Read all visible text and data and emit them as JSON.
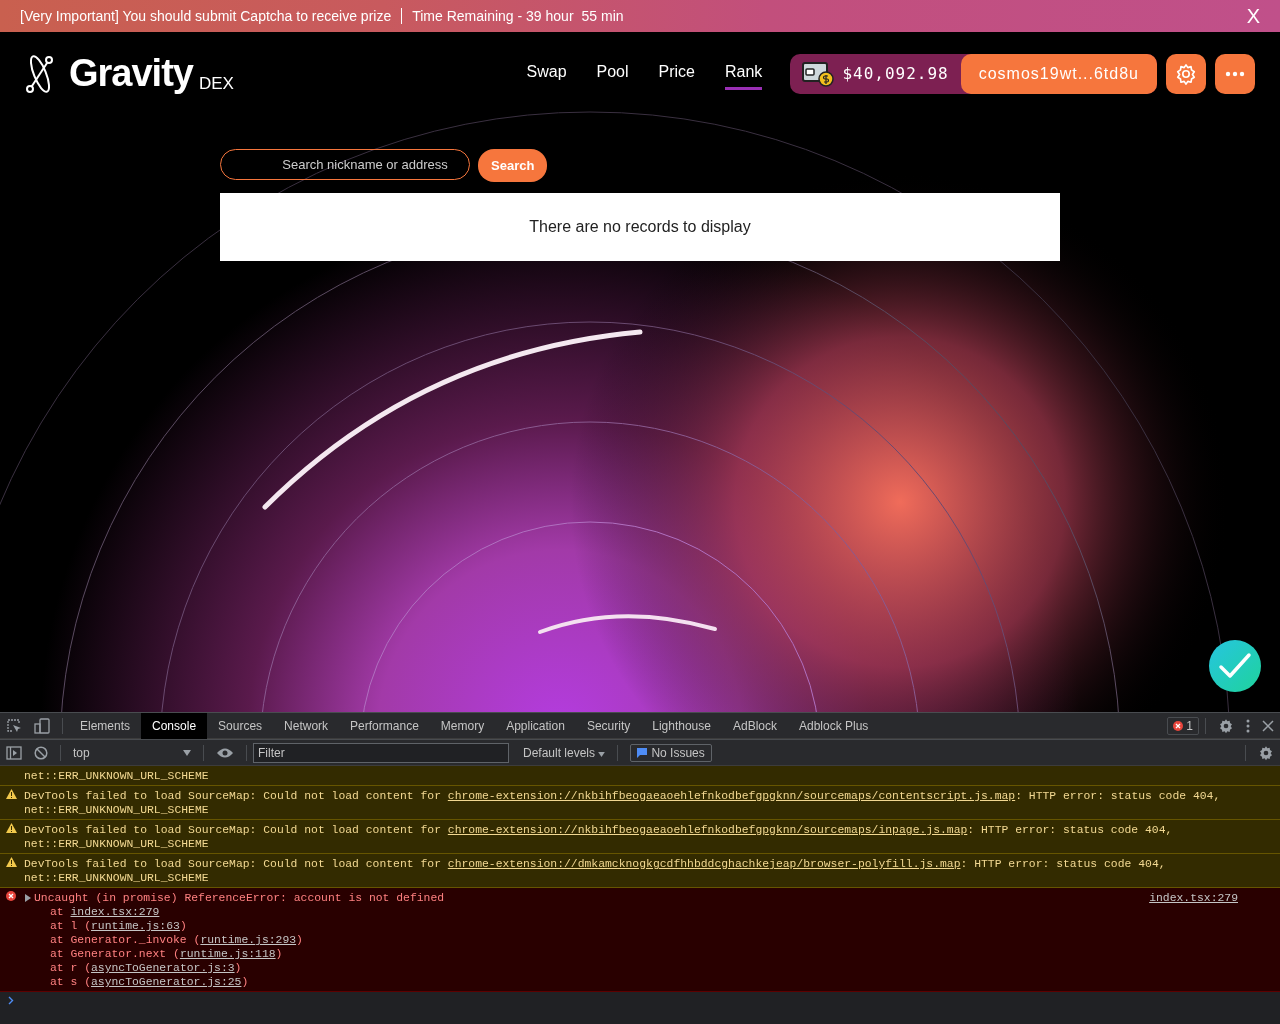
{
  "banner": {
    "message": "[Very Important] You should submit Captcha to receive prize",
    "time": "Time Remaining - 39 hour",
    "minutes": "55 min",
    "close": "X"
  },
  "header": {
    "logo": "Gravity",
    "logo_suffix": "DEX",
    "nav": [
      {
        "label": "Swap",
        "selected": false
      },
      {
        "label": "Pool",
        "selected": false
      },
      {
        "label": "Price",
        "selected": false
      },
      {
        "label": "Rank",
        "selected": true
      }
    ],
    "balance": "$40,092.98",
    "address": "cosmos19wt...6td8u"
  },
  "search": {
    "placeholder": "Search nickname or address",
    "button": "Search"
  },
  "table": {
    "empty_message": "There are no records to display"
  },
  "devtools": {
    "tabs": [
      {
        "label": "Elements",
        "selected": false
      },
      {
        "label": "Console",
        "selected": true
      },
      {
        "label": "Sources",
        "selected": false
      },
      {
        "label": "Network",
        "selected": false
      },
      {
        "label": "Performance",
        "selected": false
      },
      {
        "label": "Memory",
        "selected": false
      },
      {
        "label": "Application",
        "selected": false
      },
      {
        "label": "Security",
        "selected": false
      },
      {
        "label": "Lighthouse",
        "selected": false
      },
      {
        "label": "AdBlock",
        "selected": false
      },
      {
        "label": "Adblock Plus",
        "selected": false
      }
    ],
    "error_count": "1",
    "context": "top",
    "filter_placeholder": "Filter",
    "levels": "Default levels",
    "issues": "No Issues",
    "messages": [
      {
        "kind": "warning",
        "lines": [
          "net::ERR_UNKNOWN_URL_SCHEME"
        ]
      },
      {
        "kind": "warning",
        "prefix": "DevTools failed to load SourceMap: Could not load content for ",
        "link": "chrome-extension://nkbihfbeogaeaoehlefnkodbefgpgknn/sourcemaps/contentscript.js.map",
        "suffix": ": HTTP error: status code 404,",
        "lines": [
          "net::ERR_UNKNOWN_URL_SCHEME"
        ]
      },
      {
        "kind": "warning",
        "prefix": "DevTools failed to load SourceMap: Could not load content for ",
        "link": "chrome-extension://nkbihfbeogaeaoehlefnkodbefgpgknn/sourcemaps/inpage.js.map",
        "suffix": ": HTTP error: status code 404,",
        "lines": [
          "net::ERR_UNKNOWN_URL_SCHEME"
        ]
      },
      {
        "kind": "warning",
        "prefix": "DevTools failed to load SourceMap: Could not load content for ",
        "link": "chrome-extension://dmkamcknogkgcdfhhbddcghachkejeap/browser-polyfill.js.map",
        "suffix": ": HTTP error: status code 404,",
        "lines": [
          "net::ERR_UNKNOWN_URL_SCHEME"
        ]
      },
      {
        "kind": "error",
        "prefix": "Uncaught (in promise) ReferenceError: account is not defined",
        "source": "index.tsx:279",
        "stack": [
          {
            "prefix": "at ",
            "link": "index.tsx:279"
          },
          {
            "prefix": "at l (",
            "link": "runtime.js:63",
            "suffix": ")"
          },
          {
            "prefix": "at Generator._invoke (",
            "link": "runtime.js:293",
            "suffix": ")"
          },
          {
            "prefix": "at Generator.next (",
            "link": "runtime.js:118",
            "suffix": ")"
          },
          {
            "prefix": "at r (",
            "link": "asyncToGenerator.js:3",
            "suffix": ")"
          },
          {
            "prefix": "at s (",
            "link": "asyncToGenerator.js:25",
            "suffix": ")"
          }
        ]
      }
    ]
  }
}
